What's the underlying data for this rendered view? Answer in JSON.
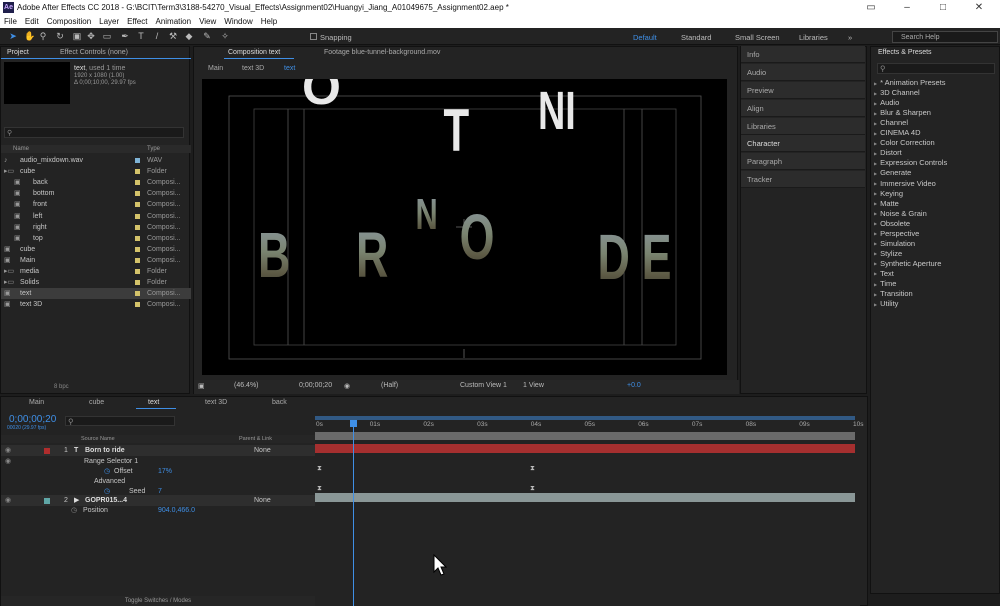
{
  "window": {
    "title": "Adobe After Effects CC 2018 - G:\\BCIT\\Term3\\3188-54270_Visual_Effects\\Assignment02\\Huangyi_Jiang_A01049675_Assignment02.aep *",
    "app_badge": "Ae"
  },
  "menu": [
    "File",
    "Edit",
    "Composition",
    "Layer",
    "Effect",
    "Animation",
    "View",
    "Window",
    "Help"
  ],
  "toolbar": {
    "snapping": "Snapping",
    "workspaces": [
      "Default",
      "Standard",
      "Small Screen",
      "Libraries"
    ],
    "search_help": "Search Help"
  },
  "project": {
    "tabs": [
      "Project",
      "Effect Controls (none)"
    ],
    "selected_name": "text",
    "selected_used": ", used 1 time",
    "info1": "1920 x 1080 (1.00)",
    "info2": "Δ 0;00;10;00, 29.97 fps",
    "search_placeholder": "",
    "col_name": "Name",
    "col_type": "Type",
    "bpc": "8 bpc",
    "items": [
      {
        "name": "audio_mixdown.wav",
        "type": "WAV",
        "indent": 0
      },
      {
        "name": "cube",
        "type": "Folder",
        "indent": 0
      },
      {
        "name": "back",
        "type": "Composi...",
        "indent": 1
      },
      {
        "name": "bottom",
        "type": "Composi...",
        "indent": 1
      },
      {
        "name": "front",
        "type": "Composi...",
        "indent": 1
      },
      {
        "name": "left",
        "type": "Composi...",
        "indent": 1
      },
      {
        "name": "right",
        "type": "Composi...",
        "indent": 1
      },
      {
        "name": "top",
        "type": "Composi...",
        "indent": 1
      },
      {
        "name": "cube",
        "type": "Composi...",
        "indent": 0
      },
      {
        "name": "Main",
        "type": "Composi...",
        "indent": 0
      },
      {
        "name": "media",
        "type": "Folder",
        "indent": 0
      },
      {
        "name": "Solids",
        "type": "Folder",
        "indent": 0
      },
      {
        "name": "text",
        "type": "Composi...",
        "indent": 0
      },
      {
        "name": "text 3D",
        "type": "Composi...",
        "indent": 0
      }
    ]
  },
  "viewer": {
    "tabs": [
      "Composition text",
      "Footage blue-tunnel-background.mov"
    ],
    "breadcrumbs": [
      "Main",
      "text 3D",
      "text"
    ],
    "zoom": "(46.4%)",
    "timecode": "0;00;00;20",
    "resolution": "(Half)",
    "view": "Custom View 1",
    "views": "1 View",
    "exposure": "+0.0",
    "letters_top": "O T NI",
    "letters_main": [
      "B",
      "R",
      "N",
      "T",
      "O",
      "D",
      "E"
    ]
  },
  "right_panels": [
    "Info",
    "Audio",
    "Preview",
    "Align",
    "Libraries",
    "Character",
    "Paragraph",
    "Tracker"
  ],
  "effects": {
    "title": "Effects & Presets",
    "search": "",
    "items": [
      "* Animation Presets",
      "3D Channel",
      "Audio",
      "Blur & Sharpen",
      "Channel",
      "CINEMA 4D",
      "Color Correction",
      "Distort",
      "Expression Controls",
      "Generate",
      "Immersive Video",
      "Keying",
      "Matte",
      "Noise & Grain",
      "Obsolete",
      "Perspective",
      "Simulation",
      "Stylize",
      "Synthetic Aperture",
      "Text",
      "Time",
      "Transition",
      "Utility"
    ]
  },
  "timeline": {
    "tabs": [
      "Main",
      "cube",
      "text",
      "text 3D",
      "back"
    ],
    "timecode": "0;00;00;20",
    "timecode_sub": "00020 (29.97 fps)",
    "search": "",
    "col_source": "Source Name",
    "col_parent": "Parent & Link",
    "layers": [
      {
        "num": "1",
        "name": "Born to ride",
        "parent": "None",
        "color": "#b02d2d"
      },
      {
        "num": "2",
        "name": "GOPR015...4",
        "parent": "None",
        "color": "#5fa6a6"
      }
    ],
    "props": {
      "range_selector": "Range Selector 1",
      "offset_label": "Offset",
      "offset_value": "17%",
      "advanced": "Advanced",
      "seed_label": "Seed",
      "seed_value": "7",
      "position_label": "Position",
      "position_value": "904.0,466.0"
    },
    "ruler": [
      "0s",
      "01s",
      "02s",
      "03s",
      "04s",
      "05s",
      "06s",
      "07s",
      "08s",
      "09s",
      "10s"
    ],
    "toggle_label": "Toggle Switches / Modes"
  },
  "colors": {
    "accent": "#3f8fe6",
    "layer1": "#b02d2d",
    "layer2": "#8a9797"
  }
}
